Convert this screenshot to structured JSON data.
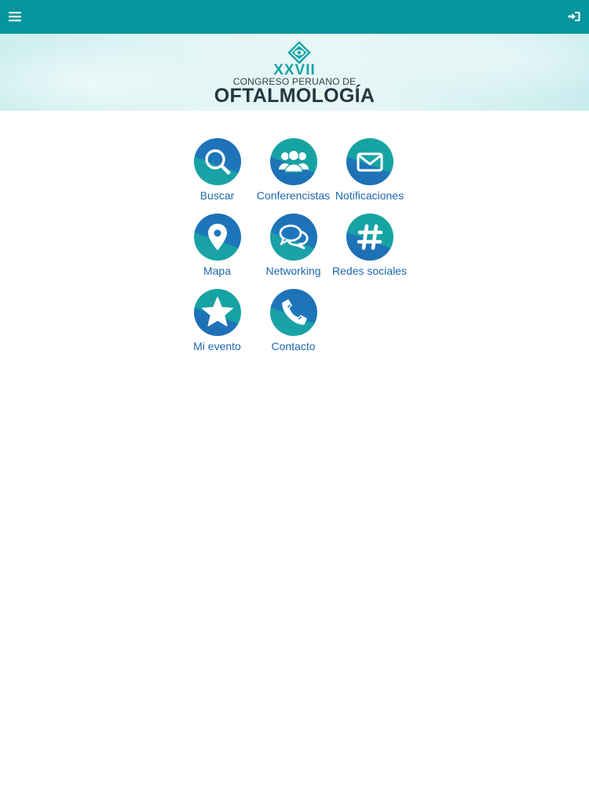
{
  "header": {
    "menu_icon": "hamburger-menu-icon",
    "login_icon": "sign-in-icon",
    "bar_color": "#05959c"
  },
  "banner": {
    "logo_roman": "XXVII",
    "logo_sub": "CONGRESO PERUANO DE",
    "logo_main": "OFTALMOLOGÍA"
  },
  "menu": {
    "items": [
      {
        "label": "Buscar",
        "icon": "search-icon"
      },
      {
        "label": "Conferencistas",
        "icon": "people-icon"
      },
      {
        "label": "Notificaciones",
        "icon": "envelope-icon"
      },
      {
        "label": "Mapa",
        "icon": "map-pin-icon"
      },
      {
        "label": "Networking",
        "icon": "chat-bubbles-icon"
      },
      {
        "label": "Redes sociales",
        "icon": "hashtag-icon"
      },
      {
        "label": "Mi evento",
        "icon": "star-icon"
      },
      {
        "label": "Contacto",
        "icon": "phone-icon"
      }
    ]
  },
  "colors": {
    "label_blue": "#1d67ac",
    "icon_blue": "#1f77bb",
    "icon_teal": "#17a2a3"
  }
}
